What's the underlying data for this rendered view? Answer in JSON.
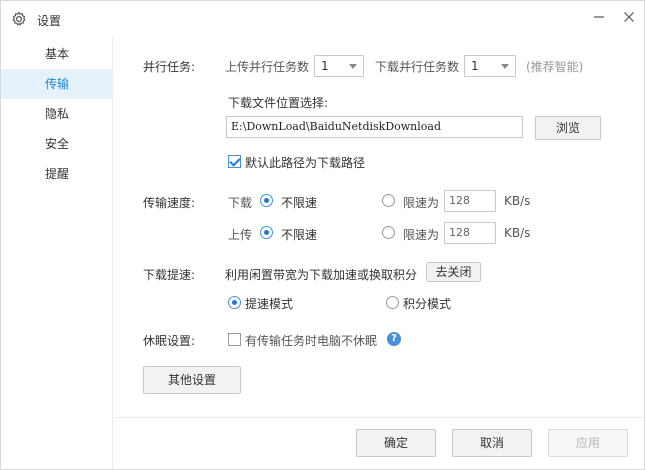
{
  "window": {
    "title": "设置"
  },
  "sidebar": {
    "items": [
      {
        "label": "基本"
      },
      {
        "label": "传输"
      },
      {
        "label": "隐私"
      },
      {
        "label": "安全"
      },
      {
        "label": "提醒"
      }
    ],
    "active_index": 1
  },
  "parallel": {
    "section_label": "并行任务:",
    "upload_label": "上传并行任务数",
    "upload_value": "1",
    "download_label": "下载并行任务数",
    "download_value": "1",
    "hint": "(推荐智能)"
  },
  "location": {
    "label": "下载文件位置选择:",
    "path": "E:\\DownLoad\\BaiduNetdiskDownload",
    "browse_label": "浏览",
    "default_checkbox_label": "默认此路径为下载路径",
    "default_checked": true
  },
  "speed": {
    "section_label": "传输速度:",
    "download_label": "下载",
    "upload_label": "上传",
    "unlimited_label": "不限速",
    "limit_label": "限速为",
    "download_limit_value": "128",
    "upload_limit_value": "128",
    "unit": "KB/s",
    "download_mode": "unlimited",
    "upload_mode": "unlimited"
  },
  "boost": {
    "section_label": "下载提速:",
    "description": "利用闲置带宽为下载加速或换取积分",
    "toggle_label": "去关闭",
    "mode_speed_label": "提速模式",
    "mode_points_label": "积分模式",
    "selected_mode": "speed"
  },
  "sleep": {
    "section_label": "休眠设置:",
    "checkbox_label": "有传输任务时电脑不休眠",
    "checked": false
  },
  "other_settings_label": "其他设置",
  "footer": {
    "ok_label": "确定",
    "cancel_label": "取消",
    "apply_label": "应用"
  },
  "colors": {
    "accent": "#1f84d6",
    "active_bg": "#e5f1fb"
  },
  "icons": {
    "title": "gear-icon",
    "minimize": "minimize-icon",
    "close": "close-icon",
    "help": "help-icon"
  }
}
